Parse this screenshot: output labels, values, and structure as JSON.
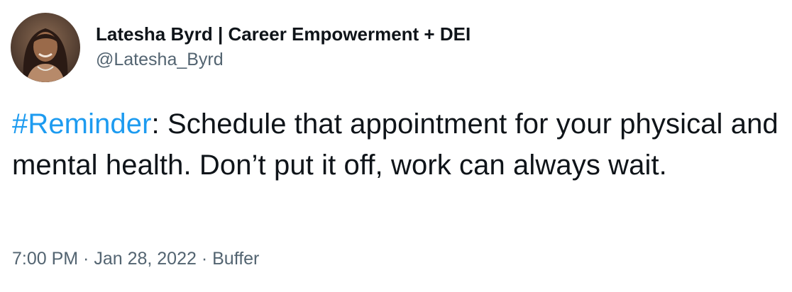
{
  "author": {
    "display_name": "Latesha Byrd | Career Empowerment + DEI",
    "handle": "@Latesha_Byrd"
  },
  "tweet": {
    "hashtag": "#Reminder",
    "text_after_hashtag": ": Schedule that appointment for your physical and mental health. Don’t put it off, work can always wait."
  },
  "meta": {
    "time": "7:00 PM",
    "separator": " · ",
    "date": "Jan 28, 2022",
    "source": "Buffer"
  },
  "colors": {
    "text": "#0f1419",
    "secondary": "#536471",
    "link": "#1d9bf0"
  }
}
